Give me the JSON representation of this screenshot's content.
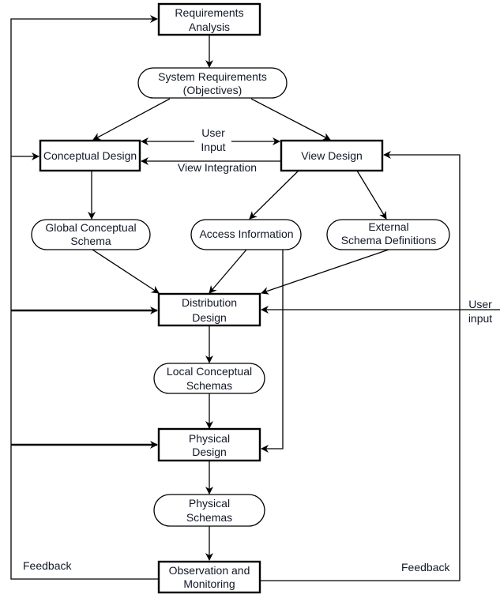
{
  "nodes": {
    "requirements_analysis": [
      "Requirements",
      "Analysis"
    ],
    "system_requirements": [
      "System Requirements",
      "(Objectives)"
    ],
    "conceptual_design": [
      "Conceptual Design"
    ],
    "view_design": [
      "View Design"
    ],
    "global_conceptual_schema": [
      "Global Conceptual",
      "Schema"
    ],
    "access_information": [
      "Access Information"
    ],
    "external_schema_definitions": [
      "External",
      "Schema Definitions"
    ],
    "distribution_design": [
      "Distribution",
      "Design"
    ],
    "local_conceptual_schemas": [
      "Local Conceptual",
      "Schemas"
    ],
    "physical_design": [
      "Physical",
      "Design"
    ],
    "physical_schemas": [
      "Physical",
      "Schemas"
    ],
    "observation_monitoring": [
      "Observation and",
      "Monitoring"
    ]
  },
  "labels": {
    "user_input_top": [
      "User",
      "Input"
    ],
    "view_integration": "View Integration",
    "user_input_right": [
      "User",
      "input"
    ],
    "feedback_left": "Feedback",
    "feedback_right": "Feedback"
  }
}
